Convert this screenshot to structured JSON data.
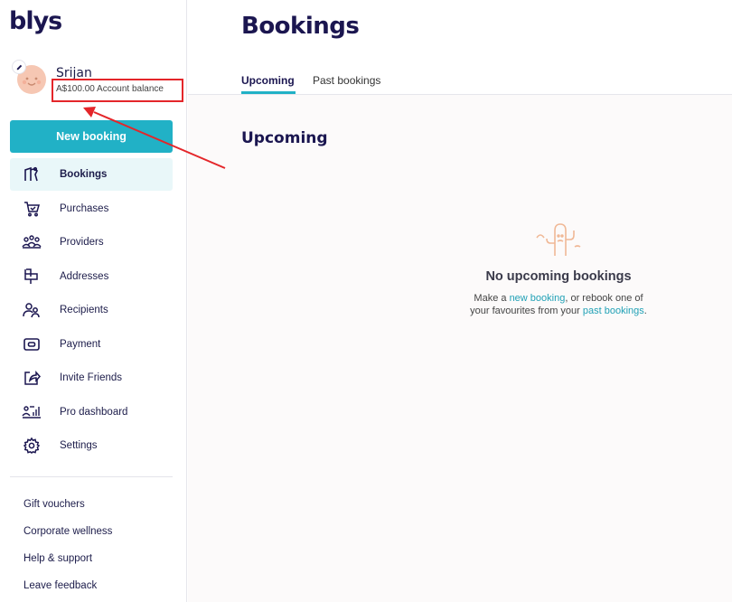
{
  "brand": {
    "logo": "blys"
  },
  "user": {
    "name": "Srijan",
    "balance": "A$100.00 Account balance"
  },
  "sidebar": {
    "new_booking_label": "New booking",
    "items": [
      {
        "label": "Bookings",
        "icon": "bookings-icon",
        "active": true
      },
      {
        "label": "Purchases",
        "icon": "cart-icon"
      },
      {
        "label": "Providers",
        "icon": "providers-icon"
      },
      {
        "label": "Addresses",
        "icon": "mailbox-icon"
      },
      {
        "label": "Recipients",
        "icon": "recipients-icon"
      },
      {
        "label": "Payment",
        "icon": "payment-icon"
      },
      {
        "label": "Invite Friends",
        "icon": "share-icon"
      },
      {
        "label": "Pro dashboard",
        "icon": "dashboard-icon"
      },
      {
        "label": "Settings",
        "icon": "gear-icon"
      }
    ],
    "links": [
      "Gift vouchers",
      "Corporate wellness",
      "Help & support",
      "Leave feedback"
    ]
  },
  "main": {
    "title": "Bookings",
    "tabs": [
      {
        "label": "Upcoming",
        "active": true
      },
      {
        "label": "Past bookings"
      }
    ],
    "section_title": "Upcoming",
    "empty": {
      "title": "No upcoming bookings",
      "line1_prefix": "Make a ",
      "link1": "new booking",
      "line1_suffix": ", or rebook one of",
      "line2_prefix": "your favourites from your ",
      "link2": "past bookings",
      "line2_suffix": "."
    }
  },
  "colors": {
    "accent": "#21b1c6",
    "brand": "#1b1650",
    "annotation": "#e4262a"
  }
}
